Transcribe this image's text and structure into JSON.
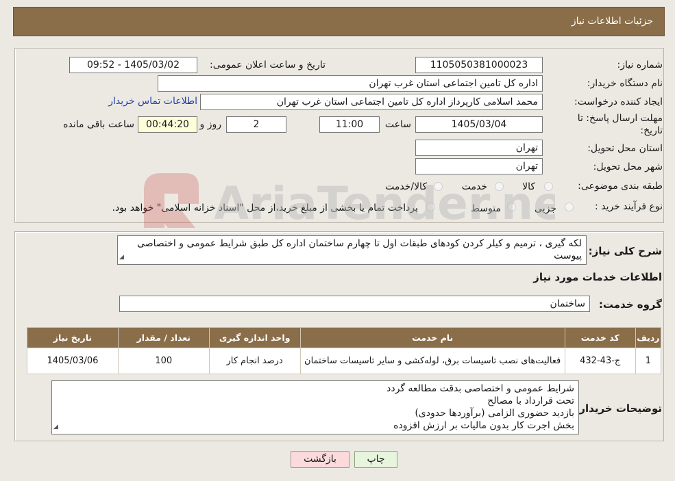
{
  "header": {
    "title": "جزئیات اطلاعات نیاز"
  },
  "form": {
    "need_number_label": "شماره نیاز:",
    "need_number": "1105050381000023",
    "announce_label": "تاریخ و ساعت اعلان عمومی:",
    "announce_value": "1405/03/02 - 09:52",
    "buyer_org_label": "نام دستگاه خریدار:",
    "buyer_org": "اداره کل تامین اجتماعی استان غرب تهران",
    "creator_label": "ایجاد کننده درخواست:",
    "creator": "محمد اسلامی کارپرداز اداره کل تامین اجتماعی استان غرب تهران",
    "contact_link": "اطلاعات تماس خریدار",
    "deadline_label_1": "مهلت ارسال پاسخ: تا",
    "deadline_label_2": "تاریخ:",
    "deadline_date": "1405/03/04",
    "time_label": "ساعت",
    "deadline_time": "11:00",
    "days_value": "2",
    "days_label": "روز و",
    "remaining_time": "00:44:20",
    "remaining_label": "ساعت باقی مانده",
    "province_label": "استان محل تحویل:",
    "province": "تهران",
    "city_label": "شهر محل تحویل:",
    "city": "تهران",
    "category_label": "طبقه بندی موضوعی:",
    "category_options": [
      "کالا",
      "خدمت",
      "کالا/خدمت"
    ],
    "process_label": "نوع فرآیند خرید :",
    "process_options": [
      "جزیی",
      "متوسط"
    ],
    "process_note": "پرداخت تمام یا بخشی از مبلغ خرید،از محل \"اسناد خزانه اسلامی\" خواهد بود."
  },
  "summary": {
    "label": "شرح کلی نیاز:",
    "text": "لکه گیری ، ترمیم و کیلر کردن کودهای طبقات اول تا چهارم ساختمان اداره کل طبق شرایط عمومی و اختصاصی پیوست"
  },
  "services": {
    "section_title": "اطلاعات خدمات مورد نیاز",
    "group_label": "گروه خدمت:",
    "group_value": "ساختمان",
    "table": {
      "headers": [
        "ردیف",
        "کد خدمت",
        "نام خدمت",
        "واحد اندازه گیری",
        "تعداد / مقدار",
        "تاریخ نیاز"
      ],
      "rows": [
        [
          "1",
          "ج-43-432",
          "فعالیت‌های نصب تاسیسات برق، لوله‌کشی و سایر تاسیسات ساختمان",
          "درصد انجام کار",
          "100",
          "1405/03/06"
        ]
      ]
    }
  },
  "buyer_notes": {
    "label": "توضیحات خریدار:",
    "lines": [
      "شرایط عمومی و اختصاصی بدقت مطالعه گردد",
      "تحت قرارداد با مصالح",
      "بازدید حضوری الزامی (برآوردها حدودی)",
      "بخش اجرت کار بدون مالیات بر ارزش افزوده"
    ]
  },
  "buttons": {
    "print": "چاپ",
    "back": "بازگشت"
  },
  "watermark": {
    "text": "AriaTender.neT"
  }
}
